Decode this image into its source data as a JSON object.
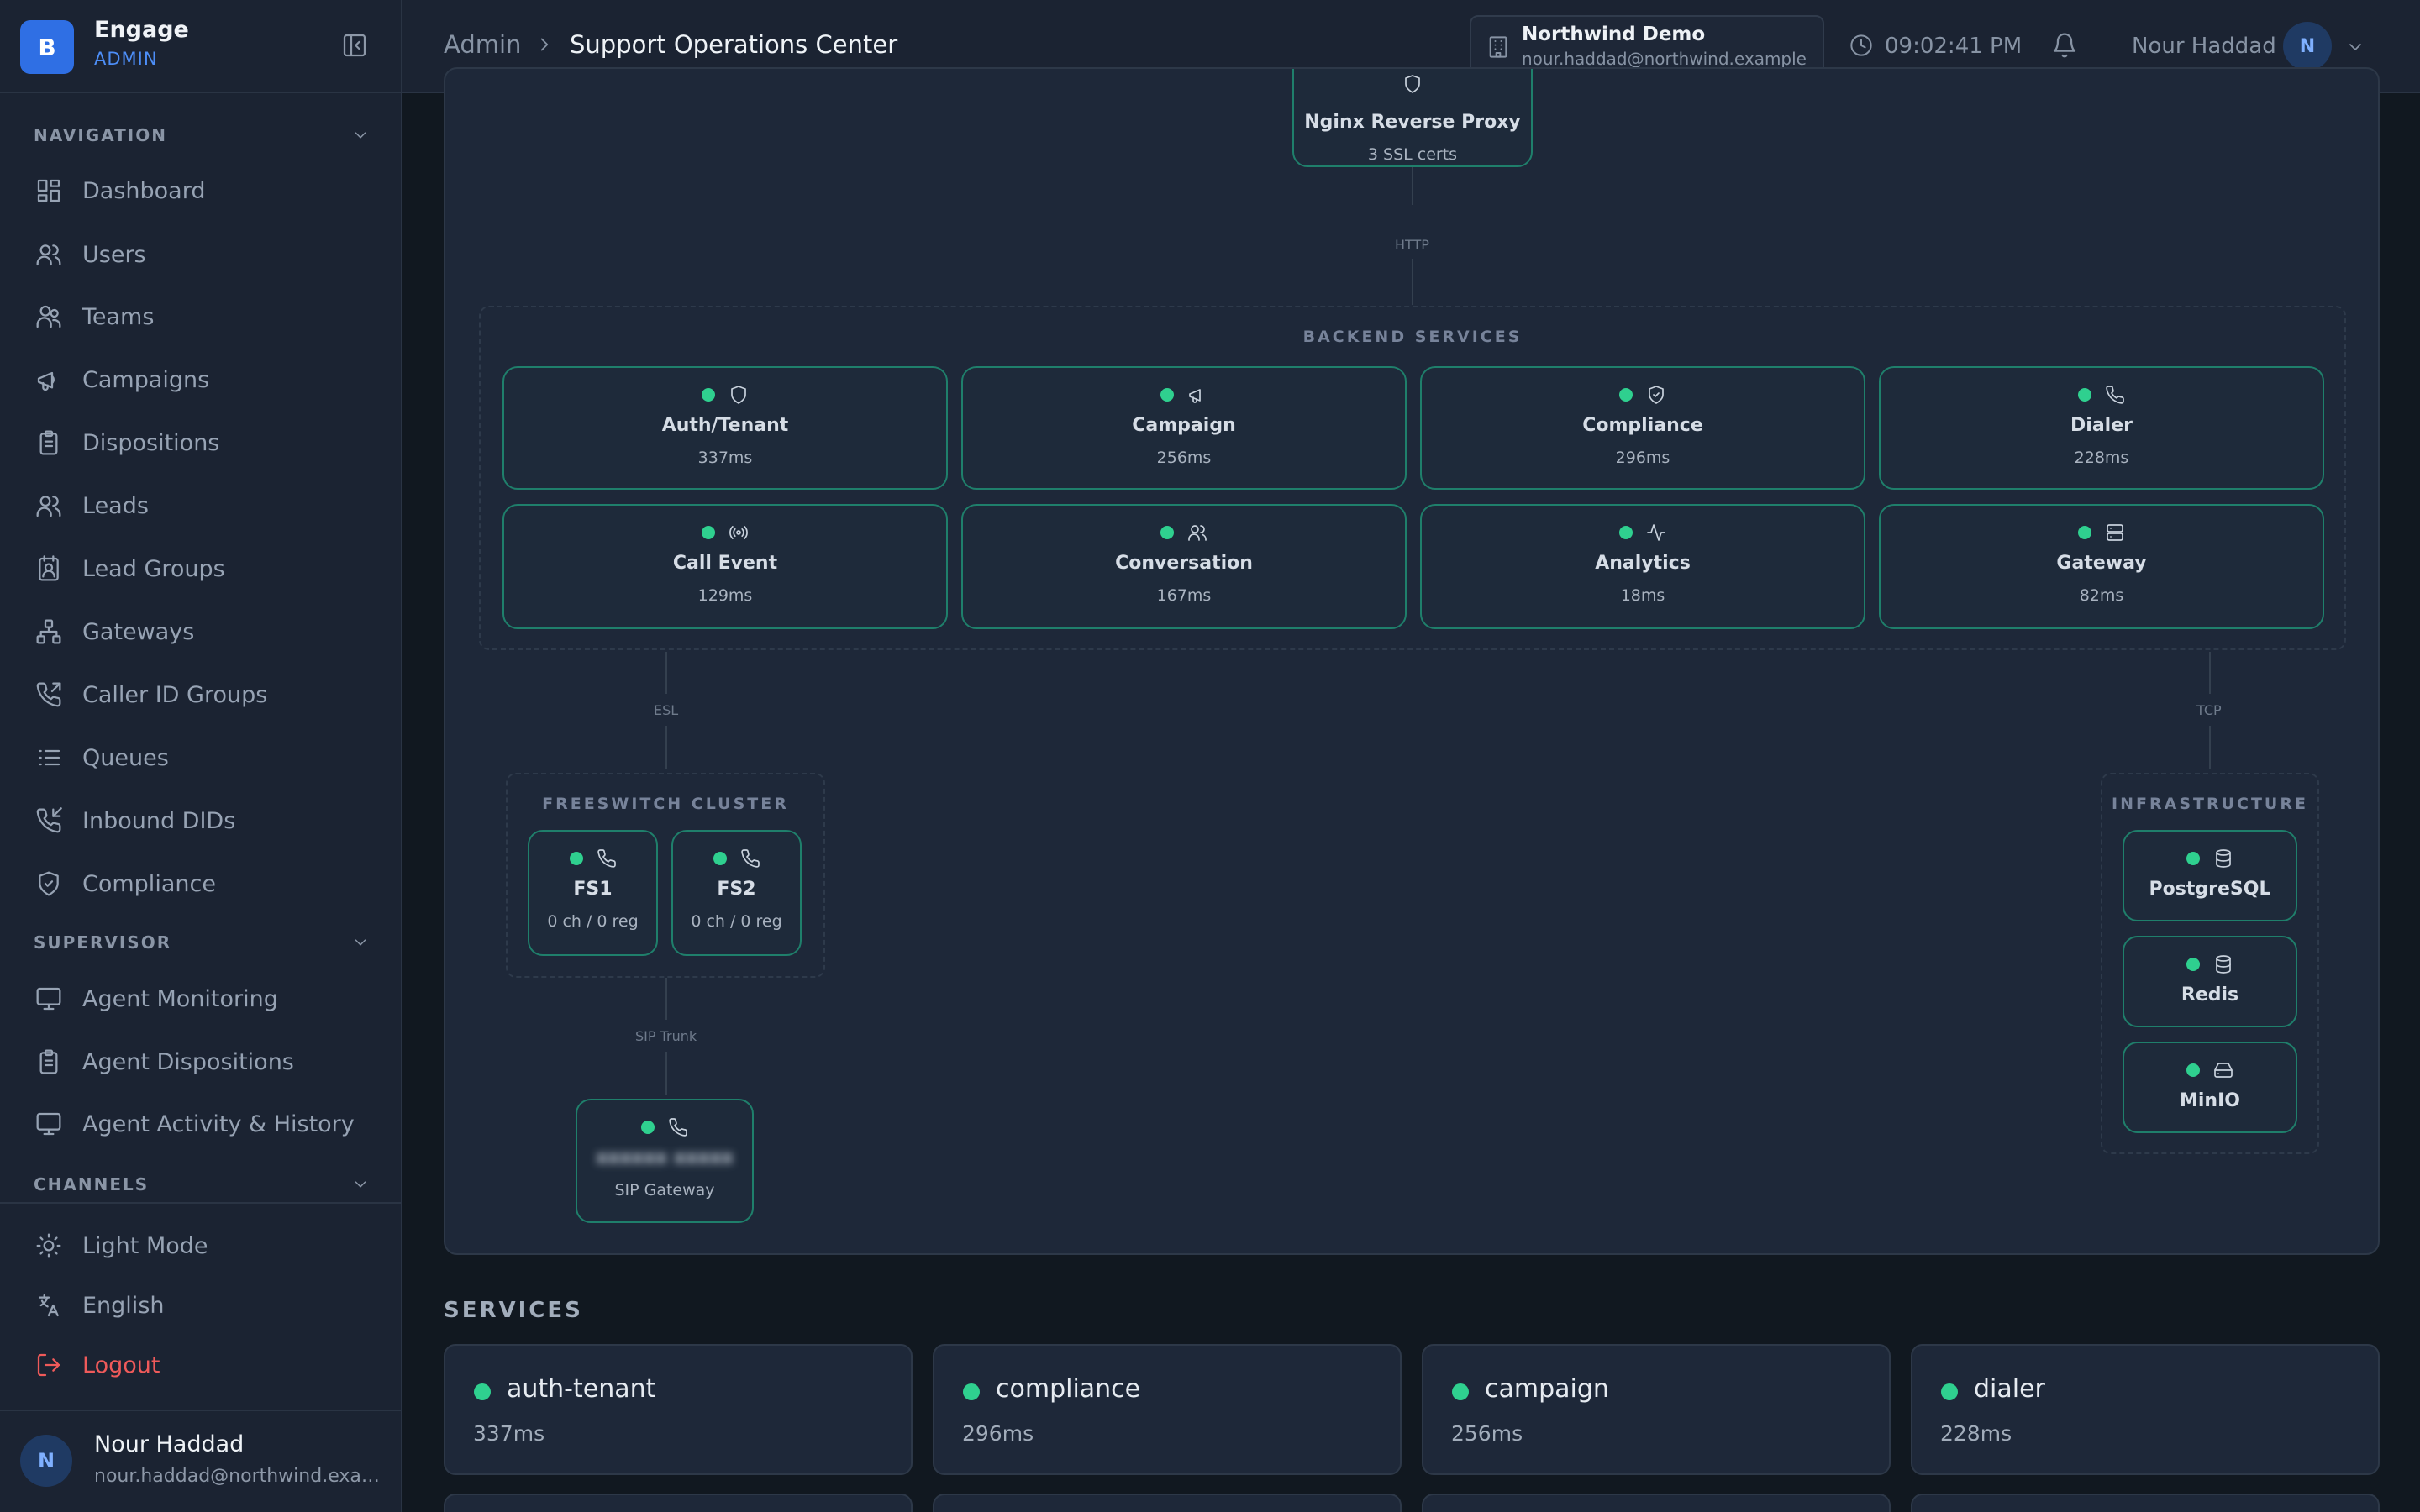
{
  "brand": {
    "logo_letter": "B",
    "name": "Engage",
    "role": "ADMIN"
  },
  "sidebar": {
    "sections": [
      {
        "title": "NAVIGATION"
      },
      {
        "title": "SUPERVISOR"
      },
      {
        "title": "CHANNELS"
      }
    ],
    "navigation": [
      {
        "label": "Dashboard",
        "icon": "dashboard-icon"
      },
      {
        "label": "Users",
        "icon": "users-icon"
      },
      {
        "label": "Teams",
        "icon": "teams-icon"
      },
      {
        "label": "Campaigns",
        "icon": "megaphone-icon"
      },
      {
        "label": "Dispositions",
        "icon": "clipboard-icon"
      },
      {
        "label": "Leads",
        "icon": "users-icon"
      },
      {
        "label": "Lead Groups",
        "icon": "contact-book-icon"
      },
      {
        "label": "Gateways",
        "icon": "network-icon"
      },
      {
        "label": "Caller ID Groups",
        "icon": "phone-outgoing-icon"
      },
      {
        "label": "Queues",
        "icon": "list-icon"
      },
      {
        "label": "Inbound DIDs",
        "icon": "phone-incoming-icon"
      },
      {
        "label": "Compliance",
        "icon": "shield-check-icon"
      }
    ],
    "supervisor": [
      {
        "label": "Agent Monitoring",
        "icon": "monitor-icon"
      },
      {
        "label": "Agent Dispositions",
        "icon": "clipboard-icon"
      },
      {
        "label": "Agent Activity & History",
        "icon": "monitor-icon"
      }
    ],
    "footer": [
      {
        "label": "Light Mode",
        "icon": "sun-icon"
      },
      {
        "label": "English",
        "icon": "translate-icon"
      },
      {
        "label": "Logout",
        "icon": "logout-icon"
      }
    ],
    "user": {
      "initial": "N",
      "name": "Nour Haddad",
      "email": "nour.haddad@northwind.example"
    }
  },
  "header": {
    "breadcrumb": {
      "root": "Admin",
      "page": "Support Operations Center"
    },
    "tenant": {
      "name": "Northwind Demo",
      "email": "nour.haddad@northwind.example"
    },
    "time": "09:02:41 PM",
    "user": {
      "name": "Nour Haddad",
      "initial": "N"
    }
  },
  "topology": {
    "proxy": {
      "title": "Nginx Reverse Proxy",
      "sub": "3 SSL certs"
    },
    "labels": {
      "http": "HTTP",
      "esl": "ESL",
      "tcp": "TCP",
      "sip_trunk": "SIP Trunk"
    },
    "backend": {
      "title": "BACKEND SERVICES",
      "services": [
        {
          "name": "Auth/Tenant",
          "latency": "337ms",
          "icon": "shield-icon"
        },
        {
          "name": "Campaign",
          "latency": "256ms",
          "icon": "megaphone-icon"
        },
        {
          "name": "Compliance",
          "latency": "296ms",
          "icon": "shield-check-icon"
        },
        {
          "name": "Dialer",
          "latency": "228ms",
          "icon": "phone-icon"
        },
        {
          "name": "Call Event",
          "latency": "129ms",
          "icon": "broadcast-icon"
        },
        {
          "name": "Conversation",
          "latency": "167ms",
          "icon": "users-icon"
        },
        {
          "name": "Analytics",
          "latency": "18ms",
          "icon": "activity-icon"
        },
        {
          "name": "Gateway",
          "latency": "82ms",
          "icon": "server-icon"
        }
      ]
    },
    "freeswitch": {
      "title": "FREESWITCH CLUSTER",
      "nodes": [
        {
          "name": "FS1",
          "stats": "0 ch / 0 reg"
        },
        {
          "name": "FS2",
          "stats": "0 ch / 0 reg"
        }
      ]
    },
    "sip_gateway": {
      "name": "xxxxxx xxxxx",
      "label": "SIP Gateway"
    },
    "infrastructure": {
      "title": "INFRASTRUCTURE",
      "nodes": [
        {
          "name": "PostgreSQL",
          "icon": "database-icon"
        },
        {
          "name": "Redis",
          "icon": "database-icon"
        },
        {
          "name": "MinIO",
          "icon": "hard-drive-icon"
        }
      ]
    }
  },
  "services": {
    "title": "SERVICES",
    "items": [
      {
        "name": "auth-tenant",
        "latency": "337ms"
      },
      {
        "name": "compliance",
        "latency": "296ms"
      },
      {
        "name": "campaign",
        "latency": "256ms"
      },
      {
        "name": "dialer",
        "latency": "228ms"
      }
    ]
  },
  "colors": {
    "accent": "#2f6fe4",
    "healthy": "#2fd08f",
    "node_border": "#1f7f6b",
    "logout": "#ef5a5a"
  }
}
